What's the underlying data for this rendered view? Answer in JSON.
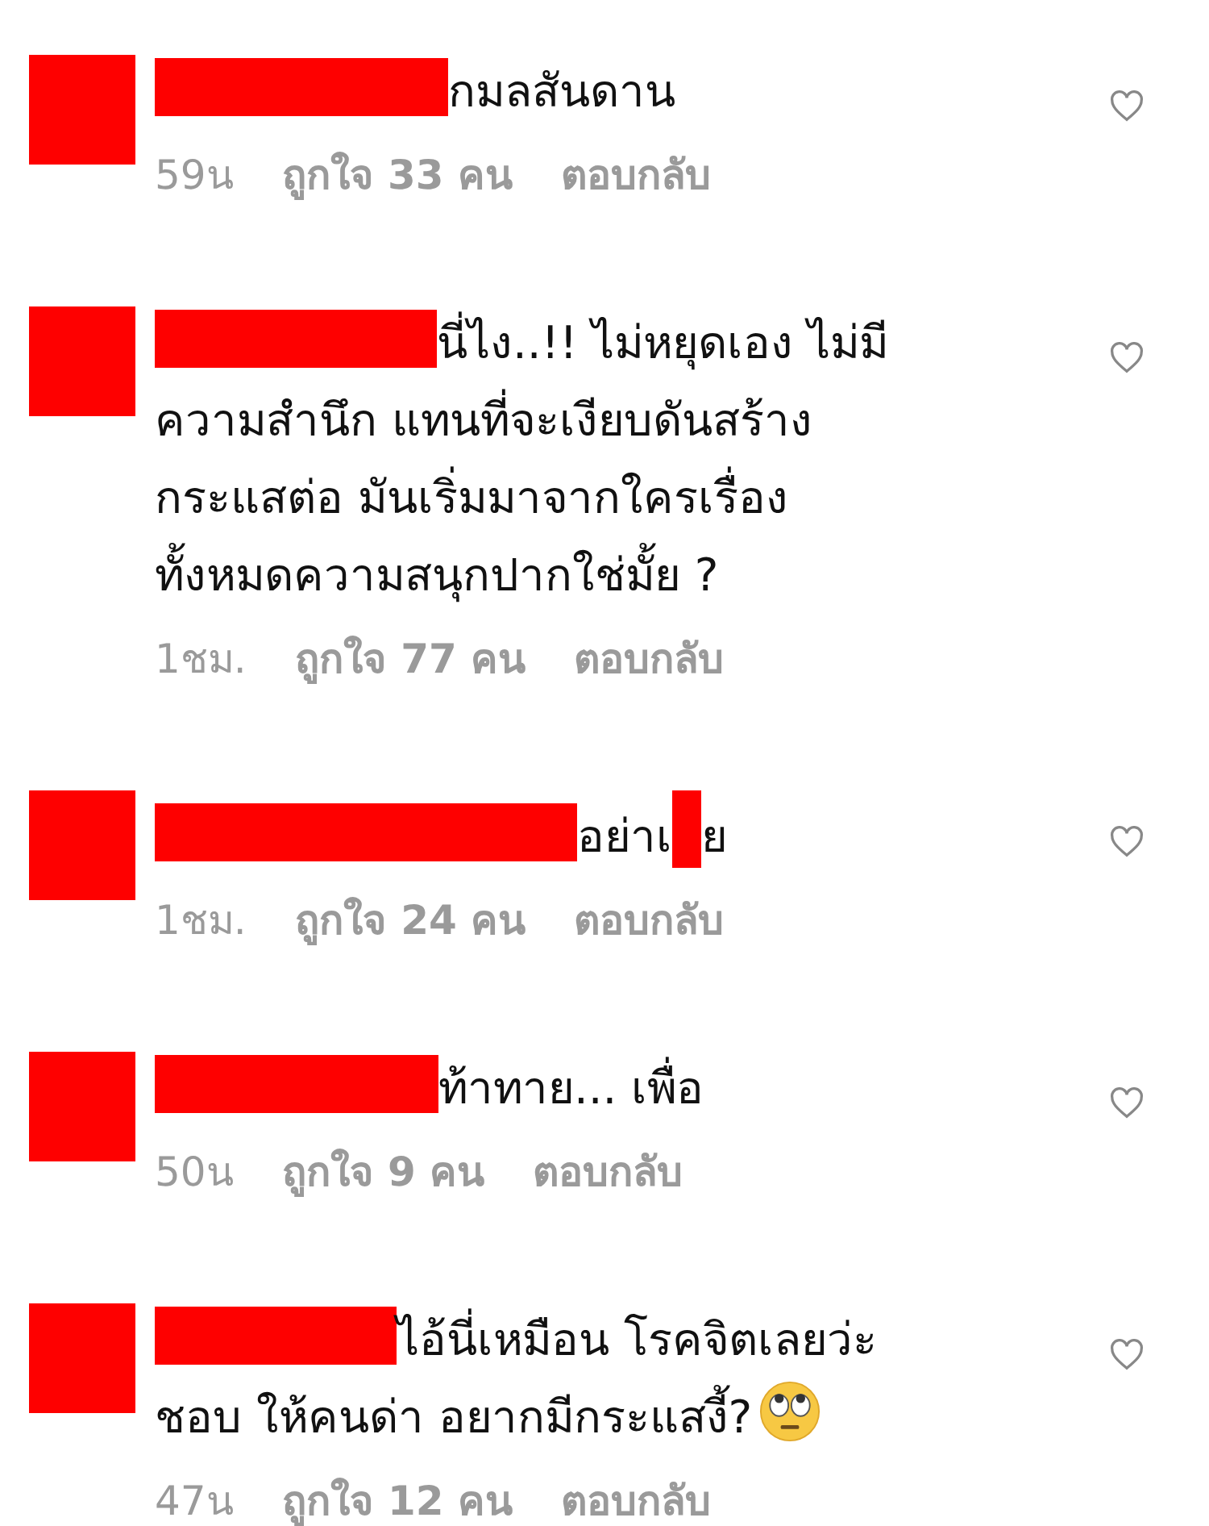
{
  "comments": [
    {
      "lines": [
        "กมลสันดาน"
      ],
      "time": "59น",
      "likes": "ถูกใจ 33 คน",
      "reply": "ตอบกลับ",
      "liked": false
    },
    {
      "lines": [
        "นี่ไง..!! ไม่หยุดเอง ไม่มี",
        "ความสำนึก แทนที่จะเงียบดันสร้าง",
        "กระแสต่อ มันเริ่มมาจากใครเรื่อง",
        "ทั้งหมดความสนุกปากใช่มั้ย ?"
      ],
      "time": "1ชม.",
      "likes": "ถูกใจ 77 คน",
      "reply": "ตอบกลับ",
      "liked": false
    },
    {
      "lines": [
        "อย่าเ"
      ],
      "text_after": "ย",
      "time": "1ชม.",
      "likes": "ถูกใจ 24 คน",
      "reply": "ตอบกลับ",
      "liked": false
    },
    {
      "lines": [
        "ท้าทาย... เพื่อ"
      ],
      "time": "50น",
      "likes": "ถูกใจ 9 คน",
      "reply": "ตอบกลับ",
      "liked": false
    },
    {
      "lines": [
        "ไอ้นี่เหมือน โรคจิตเลยว่ะ",
        "ชอบ ให้คนด่า อยากมีกระแสงี้?"
      ],
      "emoji": true,
      "time": "47น",
      "likes": "ถูกใจ 12 คน",
      "reply": "ตอบกลับ",
      "liked": false
    }
  ]
}
